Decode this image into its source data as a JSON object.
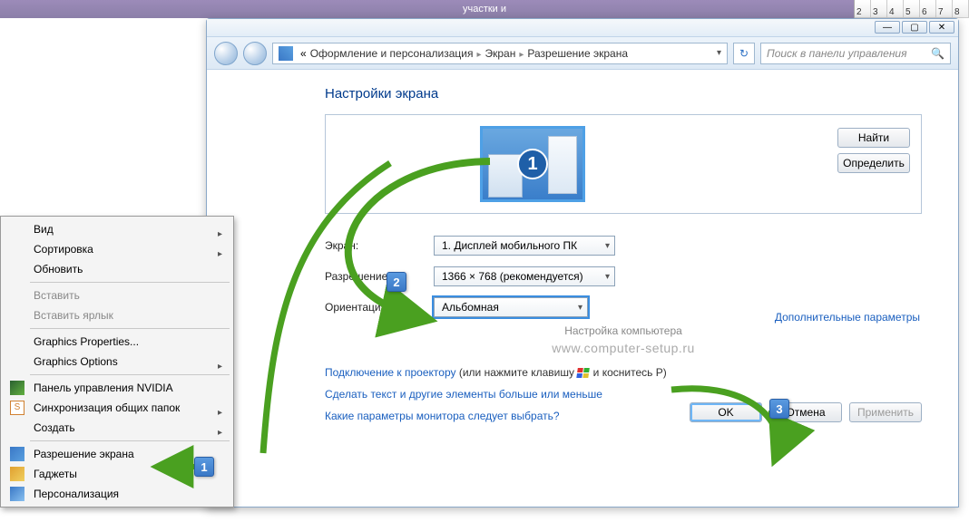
{
  "taskbar": {
    "title": "участки и",
    "calendar": [
      "2",
      "3",
      "4",
      "5",
      "6",
      "7",
      "8"
    ]
  },
  "window": {
    "breadcrumb": {
      "back_label": "«",
      "items": [
        "Оформление и персонализация",
        "Экран",
        "Разрешение экрана"
      ]
    },
    "search_placeholder": "Поиск в панели управления",
    "heading": "Настройки экрана",
    "buttons": {
      "find": "Найти",
      "detect": "Определить"
    },
    "monitor_number": "1",
    "fields": {
      "screen_label": "Экран:",
      "screen_value": "1. Дисплей мобильного ПК",
      "resolution_label": "Разрешение:",
      "resolution_value": "1366 × 768 (рекомендуется)",
      "orientation_label": "Ориентация:",
      "orientation_value": "Альбомная"
    },
    "subtext": "Настройка компьютера",
    "watermark": "www.computer-setup.ru",
    "advanced_link": "Дополнительные параметры",
    "projector": {
      "link": "Подключение к проектору",
      "rest1": " (или нажмите клавишу ",
      "rest2": " и коснитесь P)"
    },
    "textsize_link": "Сделать текст и другие элементы больше или меньше",
    "whichparams_link": "Какие параметры монитора следует выбрать?",
    "footer": {
      "ok": "OK",
      "cancel": "Отмена",
      "apply": "Применить"
    }
  },
  "context_menu": {
    "items": [
      {
        "label": "Вид",
        "sub": true
      },
      {
        "label": "Сортировка",
        "sub": true
      },
      {
        "label": "Обновить"
      },
      {
        "sep": true
      },
      {
        "label": "Вставить",
        "disabled": true
      },
      {
        "label": "Вставить ярлык",
        "disabled": true
      },
      {
        "sep": true
      },
      {
        "label": "Graphics Properties..."
      },
      {
        "label": "Graphics Options",
        "sub": true
      },
      {
        "sep": true
      },
      {
        "label": "Панель управления NVIDIA",
        "icon": "ico-nv"
      },
      {
        "label": "Синхронизация общих папок",
        "sub": true,
        "icon": "ico-sync",
        "icon_text": "S"
      },
      {
        "label": "Создать",
        "sub": true
      },
      {
        "sep": true
      },
      {
        "label": "Разрешение экрана",
        "icon": "ico-res"
      },
      {
        "label": "Гаджеты",
        "icon": "ico-gadget"
      },
      {
        "label": "Персонализация",
        "icon": "ico-pers"
      }
    ]
  },
  "callouts": {
    "c1": "1",
    "c2": "2",
    "c3": "3"
  }
}
